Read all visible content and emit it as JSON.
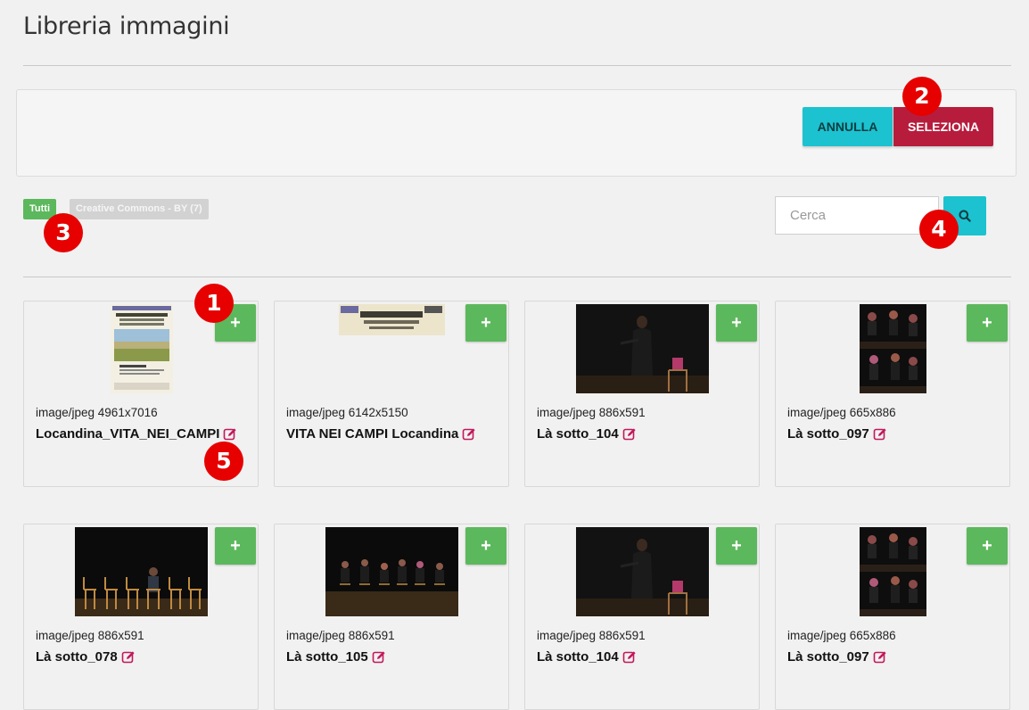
{
  "page": {
    "title": "Libreria immagini"
  },
  "toolbar": {
    "cancel_label": "ANNULLA",
    "select_label": "SELEZIONA"
  },
  "filters": {
    "all_label": "Tutti",
    "license_label": "Creative Commons - BY (7)"
  },
  "search": {
    "placeholder": "Cerca",
    "value": ""
  },
  "colors": {
    "accent": "#1cc2cf",
    "primary": "#b71c3c",
    "success": "#5cb85c",
    "marker": "#e60000"
  },
  "add_label": "+",
  "images": [
    {
      "meta": "image/jpeg 4961x7016",
      "name": "Locandina_VITA_NEI_CAMPI",
      "thumb": "poster-portrait"
    },
    {
      "meta": "image/jpeg 6142x5150",
      "name": "VITA NEI CAMPI Locandina",
      "thumb": "poster-landscape"
    },
    {
      "meta": "image/jpeg 886x591",
      "name": "Là sotto_104",
      "thumb": "stage-singer"
    },
    {
      "meta": "image/jpeg 665x886",
      "name": "Là sotto_097",
      "thumb": "stage-group-portrait"
    },
    {
      "meta": "image/jpeg 886x591",
      "name": "Là sotto_078",
      "thumb": "stage-chairs"
    },
    {
      "meta": "image/jpeg 886x591",
      "name": "Là sotto_105",
      "thumb": "stage-ensemble"
    },
    {
      "meta": "image/jpeg 886x591",
      "name": "Là sotto_104",
      "thumb": "stage-singer"
    },
    {
      "meta": "image/jpeg 665x886",
      "name": "Là sotto_097",
      "thumb": "stage-group-portrait"
    }
  ],
  "markers": [
    "1",
    "2",
    "3",
    "4",
    "5"
  ]
}
